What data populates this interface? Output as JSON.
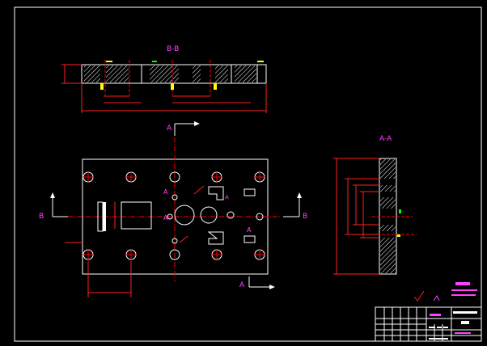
{
  "drawing": {
    "section_bb_label": "B-B",
    "section_aa_label": "A-A",
    "cut_label_a": "A",
    "cut_label_b": "B"
  },
  "colors": {
    "background": "#000000",
    "outline": "#ffffff",
    "dimension": "#ff2020",
    "cutline": "#ff00ff",
    "hatch": "#ffffff",
    "center": "#ff0000",
    "annotation_yellow": "#ffff00",
    "annotation_green": "#00ff00",
    "note_magenta": "#ff44ff",
    "titleblock_line": "#ffffff",
    "titleblock_text": "#ff44ff"
  },
  "icons": {
    "section_arrow": "arrow-icon",
    "roughness_symbol": "check-mark-icon"
  }
}
